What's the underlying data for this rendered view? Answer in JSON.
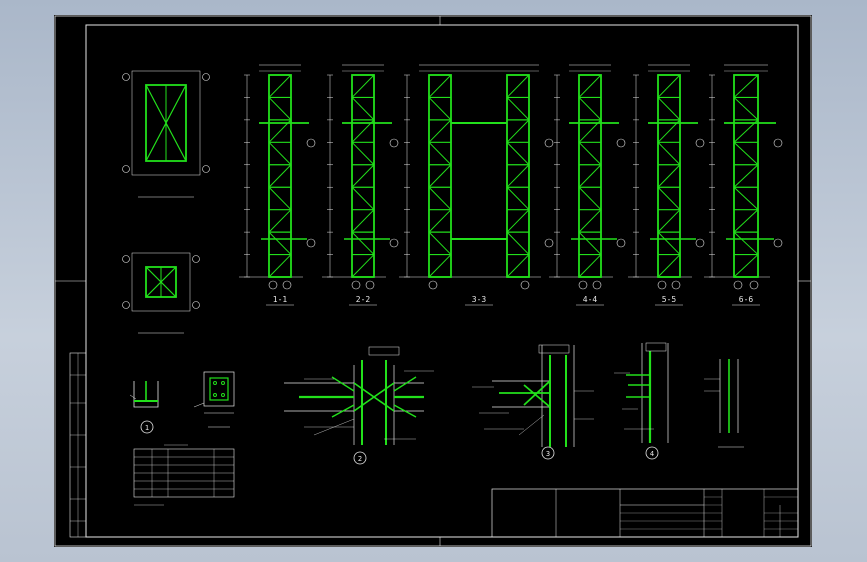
{
  "sections": [
    {
      "id": "s1",
      "label": "1-1"
    },
    {
      "id": "s2",
      "label": "2-2"
    },
    {
      "id": "s3",
      "label": "3-3"
    },
    {
      "id": "s4",
      "label": "4-4"
    },
    {
      "id": "s5",
      "label": "5-5"
    },
    {
      "id": "s6",
      "label": "6-6"
    }
  ],
  "details": [
    {
      "id": "d1",
      "label": "1"
    },
    {
      "id": "d2",
      "label": "2"
    },
    {
      "id": "d3",
      "label": "3"
    },
    {
      "id": "d4",
      "label": "4"
    }
  ],
  "colors": {
    "member": "#22e01b",
    "line": "#e6e6e6",
    "background": "#000000",
    "desk": "#b9c3d1"
  }
}
